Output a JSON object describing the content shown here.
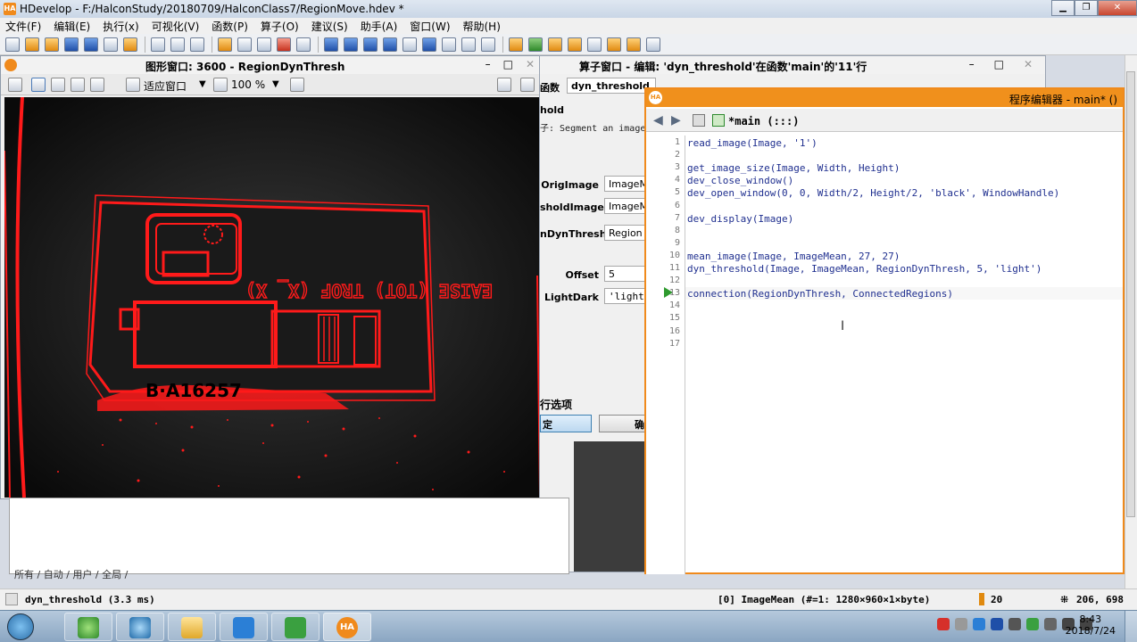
{
  "app": {
    "title": "HDevelop - F:/HalconStudy/20180709/HalconClass7/RegionMove.hdev *",
    "logo": "HA"
  },
  "menu": [
    "文件(F)",
    "编辑(E)",
    "执行(x)",
    "可视化(V)",
    "函数(P)",
    "算子(O)",
    "建议(S)",
    "助手(A)",
    "窗口(W)",
    "帮助(H)"
  ],
  "graphics_window": {
    "title": "图形窗口: 3600 - RegionDynThresh",
    "fit_label": "适应窗口",
    "zoom_label": "100 %",
    "image_text": "B·A16257",
    "image_label_text": "EAISE  (TOT)  TROF  (X_ X)"
  },
  "operator_window": {
    "title": "算子窗口 - 编辑: 'dyn_threshold'在函数'main'的'11'行",
    "function_label": "函数",
    "function_value": "dyn_threshold",
    "operator_name": "hold",
    "description": "子: Segment an image",
    "params": [
      {
        "label": "OrigImage",
        "value": "ImageM"
      },
      {
        "label": "sholdImage",
        "value": "ImageM"
      },
      {
        "label": "nDynThresh",
        "value": "Region"
      },
      {
        "label": "Offset",
        "value": "5"
      },
      {
        "label": "LightDark",
        "value": "'light"
      }
    ],
    "section_label": "行选项",
    "ok_button": "定",
    "cancel_button": "确"
  },
  "lower_tabs": "所有 / 自动 / 用户 / 全局 /",
  "program_editor": {
    "title": "程序编辑器 - main* ()",
    "logo": "HA",
    "procedure": "*main (:::)",
    "current_line": 13,
    "lines": [
      "read_image(Image, '1')",
      "",
      "get_image_size(Image, Width, Height)",
      "dev_close_window()",
      "dev_open_window(0, 0, Width/2, Height/2, 'black', WindowHandle)",
      "",
      "dev_display(Image)",
      "",
      "",
      "mean_image(Image, ImageMean, 27, 27)",
      "dyn_threshold(Image, ImageMean, RegionDynThresh, 5, 'light')",
      "",
      "connection(RegionDynThresh, ConnectedRegions)",
      "",
      "",
      "",
      ""
    ]
  },
  "status_bar": {
    "left": "dyn_threshold (3.3 ms)",
    "mid": "[0] ImageMean (#=1: 1280×960×1×byte)",
    "count": "20",
    "coords": "206, 698"
  },
  "taskbar": {
    "time": "8:43",
    "date": "2018/7/24",
    "apps": [
      "ie-icon",
      "media-icon",
      "folder-icon",
      "word-icon",
      "excel-icon",
      "halcon-icon"
    ],
    "halcon_label": "HA"
  },
  "colors": {
    "accent": "#f0901c",
    "region": "#ff1a1a",
    "code": "#1f2f8f"
  }
}
